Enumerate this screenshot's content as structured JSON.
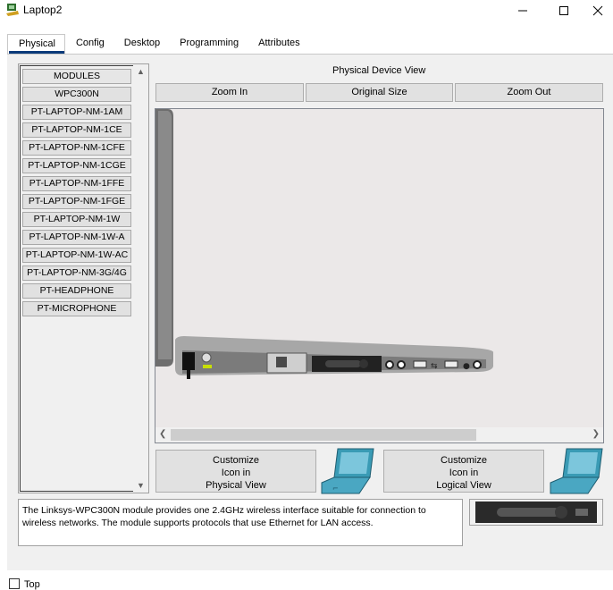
{
  "window": {
    "title": "Laptop2",
    "app_icon": "packet-tracer-laptop-icon",
    "controls": {
      "minimize": "minimize-icon",
      "maximize": "maximize-icon",
      "close": "close-icon"
    }
  },
  "tabs": [
    {
      "label": "Physical",
      "active": true
    },
    {
      "label": "Config"
    },
    {
      "label": "Desktop"
    },
    {
      "label": "Programming"
    },
    {
      "label": "Attributes"
    }
  ],
  "modules": {
    "items": [
      "MODULES",
      "WPC300N",
      "PT-LAPTOP-NM-1AM",
      "PT-LAPTOP-NM-1CE",
      "PT-LAPTOP-NM-1CFE",
      "PT-LAPTOP-NM-1CGE",
      "PT-LAPTOP-NM-1FFE",
      "PT-LAPTOP-NM-1FGE",
      "PT-LAPTOP-NM-1W",
      "PT-LAPTOP-NM-1W-A",
      "PT-LAPTOP-NM-1W-AC",
      "PT-LAPTOP-NM-3G/4G",
      "PT-HEADPHONE",
      "PT-MICROPHONE"
    ]
  },
  "physical_view": {
    "label": "Physical Device View",
    "zoom_in": "Zoom In",
    "original_size": "Original Size",
    "zoom_out": "Zoom Out"
  },
  "customize": {
    "physical": [
      "Customize",
      "Icon in",
      "Physical View"
    ],
    "logical": [
      "Customize",
      "Icon in",
      "Logical View"
    ]
  },
  "description": "The Linksys-WPC300N module provides one 2.4GHz wireless interface suitable for connection to wireless networks. The module supports protocols that use Ethernet for LAN access.",
  "footer": {
    "top_label": "Top",
    "top_checked": false
  },
  "colors": {
    "accent": "#0a3a7a",
    "laptop_icon_teal": "#3a9bb5"
  }
}
